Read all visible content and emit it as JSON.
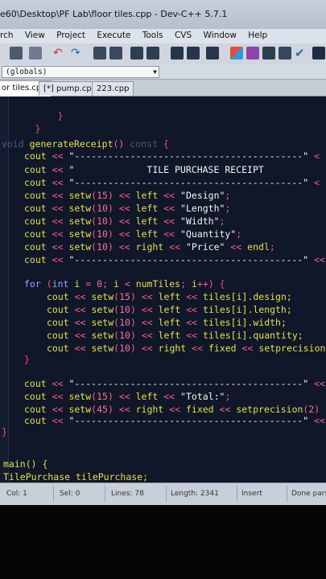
{
  "window": {
    "title": "e60\\Desktop\\PF Lab\\floor tiles.cpp - Dev-C++ 5.7.1"
  },
  "menu": [
    "rch",
    "View",
    "Project",
    "Execute",
    "Tools",
    "CVS",
    "Window",
    "Help"
  ],
  "scope": {
    "value": "(globals)"
  },
  "tabs": [
    {
      "label": "or tiles.cpp",
      "active": true
    },
    {
      "label": "[*] pump.cpp",
      "active": false
    },
    {
      "label": "223.cpp",
      "active": false
    }
  ],
  "code": {
    "l01": "}",
    "l02": "}",
    "l03_kw": "void",
    "l03_fn": "generateReceipt",
    "l03_const": "const",
    "cout": "cout",
    "dashes": "\"-----------------------------------------\"",
    "header_str": "TILE PURCHASE RECEIPT",
    "setw15": "setw(15)",
    "setw10": "setw(10)",
    "left": "left",
    "right": "right",
    "fixed": "fixed",
    "endl": "endl",
    "s_design": "\"Design\"",
    "s_length": "\"Length\"",
    "s_width": "\"Width\"",
    "s_quantity": "\"Quantity\"",
    "s_price": "\"Price\"",
    "for_line": "for",
    "for_rest": "(int i = 0; i < numTiles; i++) {",
    "tiles_design": "tiles[i].design;",
    "tiles_length": "tiles[i].length;",
    "tiles_width": "tiles[i].width;",
    "tiles_quantity": "tiles[i].quantity;",
    "setprecision": "setprecision",
    "total_str": "\"Total:\"",
    "setw45": "setw(45)",
    "setprecision2": "setprecision(2)",
    "main": "main() {",
    "tilepurchase": "TilePurchase tilePurchase;"
  },
  "status": {
    "col": "Col:   1",
    "sel": "Sel:   0",
    "lines": "Lines:   78",
    "length": "Length:  2341",
    "insert": "Insert",
    "done": "Done pars"
  }
}
